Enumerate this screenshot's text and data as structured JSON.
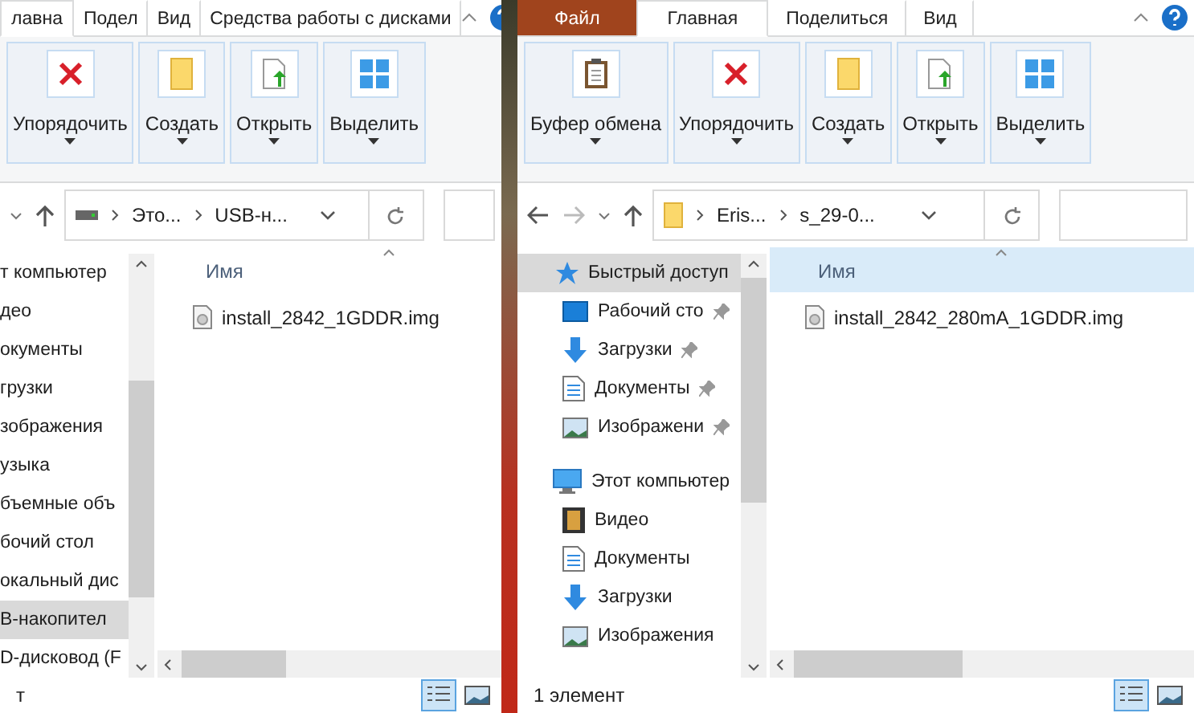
{
  "windows": [
    {
      "tabs": [
        {
          "label": "лавна",
          "kind": "tab",
          "selected": true
        },
        {
          "label": "Подел",
          "kind": "tab",
          "selected": false
        },
        {
          "label": "Вид",
          "kind": "tab",
          "selected": false
        },
        {
          "label": "Средства работы с дисками",
          "kind": "tab",
          "selected": false
        }
      ],
      "ribbon_groups": [
        {
          "label": "Упорядочить",
          "kind": "delete"
        },
        {
          "label": "Создать",
          "kind": "new"
        },
        {
          "label": "Открыть",
          "kind": "open"
        },
        {
          "label": "Выделить",
          "kind": "select"
        }
      ],
      "kind": "drive",
      "navigation": {
        "path": [
          "Это...",
          "USB-н..."
        ]
      },
      "nav_items": [
        {
          "label": "т компьютер",
          "kind": "cut",
          "selected": false,
          "pinned": false
        },
        {
          "label": "део",
          "kind": "cut",
          "selected": false,
          "pinned": false
        },
        {
          "label": "окументы",
          "kind": "cut",
          "selected": false,
          "pinned": false
        },
        {
          "label": "грузки",
          "kind": "cut",
          "selected": false,
          "pinned": false
        },
        {
          "label": "зображения",
          "kind": "cut",
          "selected": false,
          "pinned": false
        },
        {
          "label": "узыка",
          "kind": "cut",
          "selected": false,
          "pinned": false
        },
        {
          "label": "бъемные объ",
          "kind": "cut",
          "selected": false,
          "pinned": false
        },
        {
          "label": "бочий стол",
          "kind": "cut",
          "selected": false,
          "pinned": false
        },
        {
          "label": "окальный дис",
          "kind": "cut",
          "selected": false,
          "pinned": false
        },
        {
          "label": "B-накопител",
          "kind": "cut",
          "selected": true,
          "pinned": false
        },
        {
          "label": "D-дисковод (F",
          "kind": "cut",
          "selected": false,
          "pinned": false
        }
      ],
      "column": {
        "label": "Имя",
        "highlighted": false
      },
      "files": [
        {
          "name": "install_2842_1GDDR.img"
        }
      ],
      "status": "т"
    },
    {
      "tabs": [
        {
          "label": "Файл",
          "kind": "file",
          "selected": false
        },
        {
          "label": "Главная",
          "kind": "tab",
          "selected": true
        },
        {
          "label": "Поделиться",
          "kind": "tab",
          "selected": false
        },
        {
          "label": "Вид",
          "kind": "tab",
          "selected": false
        }
      ],
      "ribbon_groups": [
        {
          "label": "Буфер обмена",
          "kind": "clipboard"
        },
        {
          "label": "Упорядочить",
          "kind": "delete"
        },
        {
          "label": "Создать",
          "kind": "new"
        },
        {
          "label": "Открыть",
          "kind": "open"
        },
        {
          "label": "Выделить",
          "kind": "select"
        }
      ],
      "kind": "folder",
      "navigation": {
        "path": [
          "Eris...",
          "s_29-0..."
        ]
      },
      "nav_items": [
        {
          "label": "Быстрый доступ",
          "kind": "quick",
          "selected": true,
          "pinned": false
        },
        {
          "label": "Рабочий сто",
          "kind": "desktop",
          "selected": false,
          "pinned": true
        },
        {
          "label": "Загрузки",
          "kind": "downloads",
          "selected": false,
          "pinned": true
        },
        {
          "label": "Документы",
          "kind": "documents",
          "selected": false,
          "pinned": true
        },
        {
          "label": "Изображени",
          "kind": "pictures",
          "selected": false,
          "pinned": true
        },
        {
          "label": "Этот компьютер",
          "kind": "computer",
          "selected": false,
          "pinned": false
        },
        {
          "label": "Видео",
          "kind": "video",
          "selected": false,
          "pinned": false
        },
        {
          "label": "Документы",
          "kind": "documents",
          "selected": false,
          "pinned": false
        },
        {
          "label": "Загрузки",
          "kind": "downloads",
          "selected": false,
          "pinned": false
        },
        {
          "label": "Изображения",
          "kind": "pictures",
          "selected": false,
          "pinned": false
        }
      ],
      "column": {
        "label": "Имя",
        "highlighted": true
      },
      "files": [
        {
          "name": "install_2842_280mA_1GDDR.img"
        }
      ],
      "status": "1 элемент"
    }
  ]
}
